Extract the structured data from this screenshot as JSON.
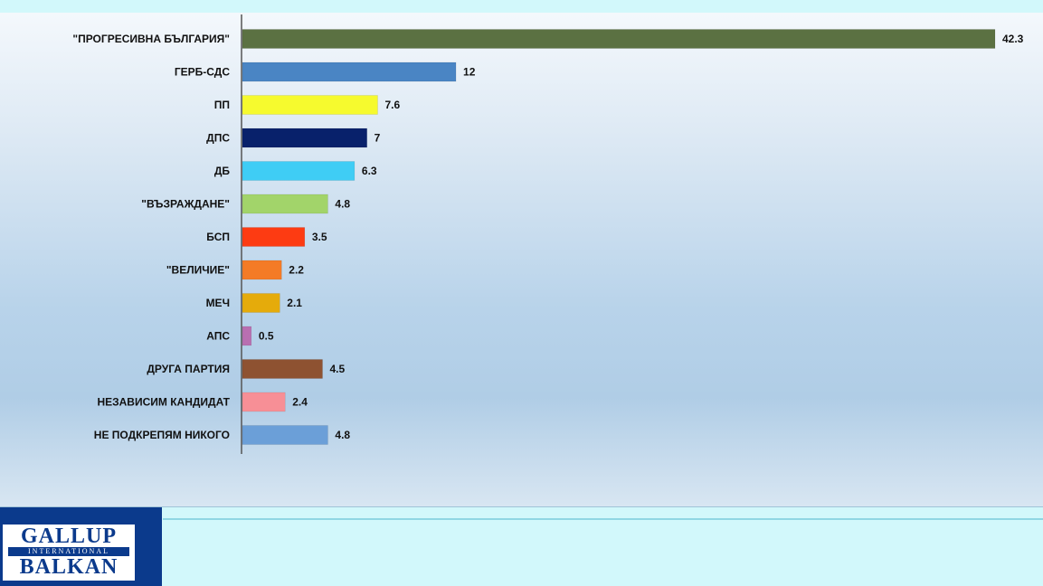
{
  "chart_data": {
    "type": "bar",
    "orientation": "horizontal",
    "categories": [
      "\"ПРОГРЕСИВНА БЪЛГАРИЯ\"",
      "ГЕРБ-СДС",
      "ПП",
      "ДПС",
      "ДБ",
      "\"ВЪЗРАЖДАНЕ\"",
      "БСП",
      "\"ВЕЛИЧИЕ\"",
      "МЕЧ",
      "АПС",
      "ДРУГА ПАРТИЯ",
      "НЕЗАВИСИМ КАНДИДАТ",
      "НЕ ПОДКРЕПЯМ НИКОГО"
    ],
    "values": [
      42.3,
      12,
      7.6,
      7,
      6.3,
      4.8,
      3.5,
      2.2,
      2.1,
      0.5,
      4.5,
      2.4,
      4.8
    ],
    "colors": [
      "#5b7142",
      "#4a85c4",
      "#f6fa2e",
      "#08216b",
      "#3fcdf5",
      "#a2d46a",
      "#fd3b12",
      "#f47b26",
      "#e5ab0b",
      "#b96fb1",
      "#8e5231",
      "#f78f96",
      "#6b9fd8"
    ],
    "xlim": [
      0,
      42.3
    ],
    "grid": false,
    "legend": "none"
  },
  "logo": {
    "line1": "GALLUP",
    "line2": "INTERNATIONAL",
    "line3": "BALKAN"
  }
}
